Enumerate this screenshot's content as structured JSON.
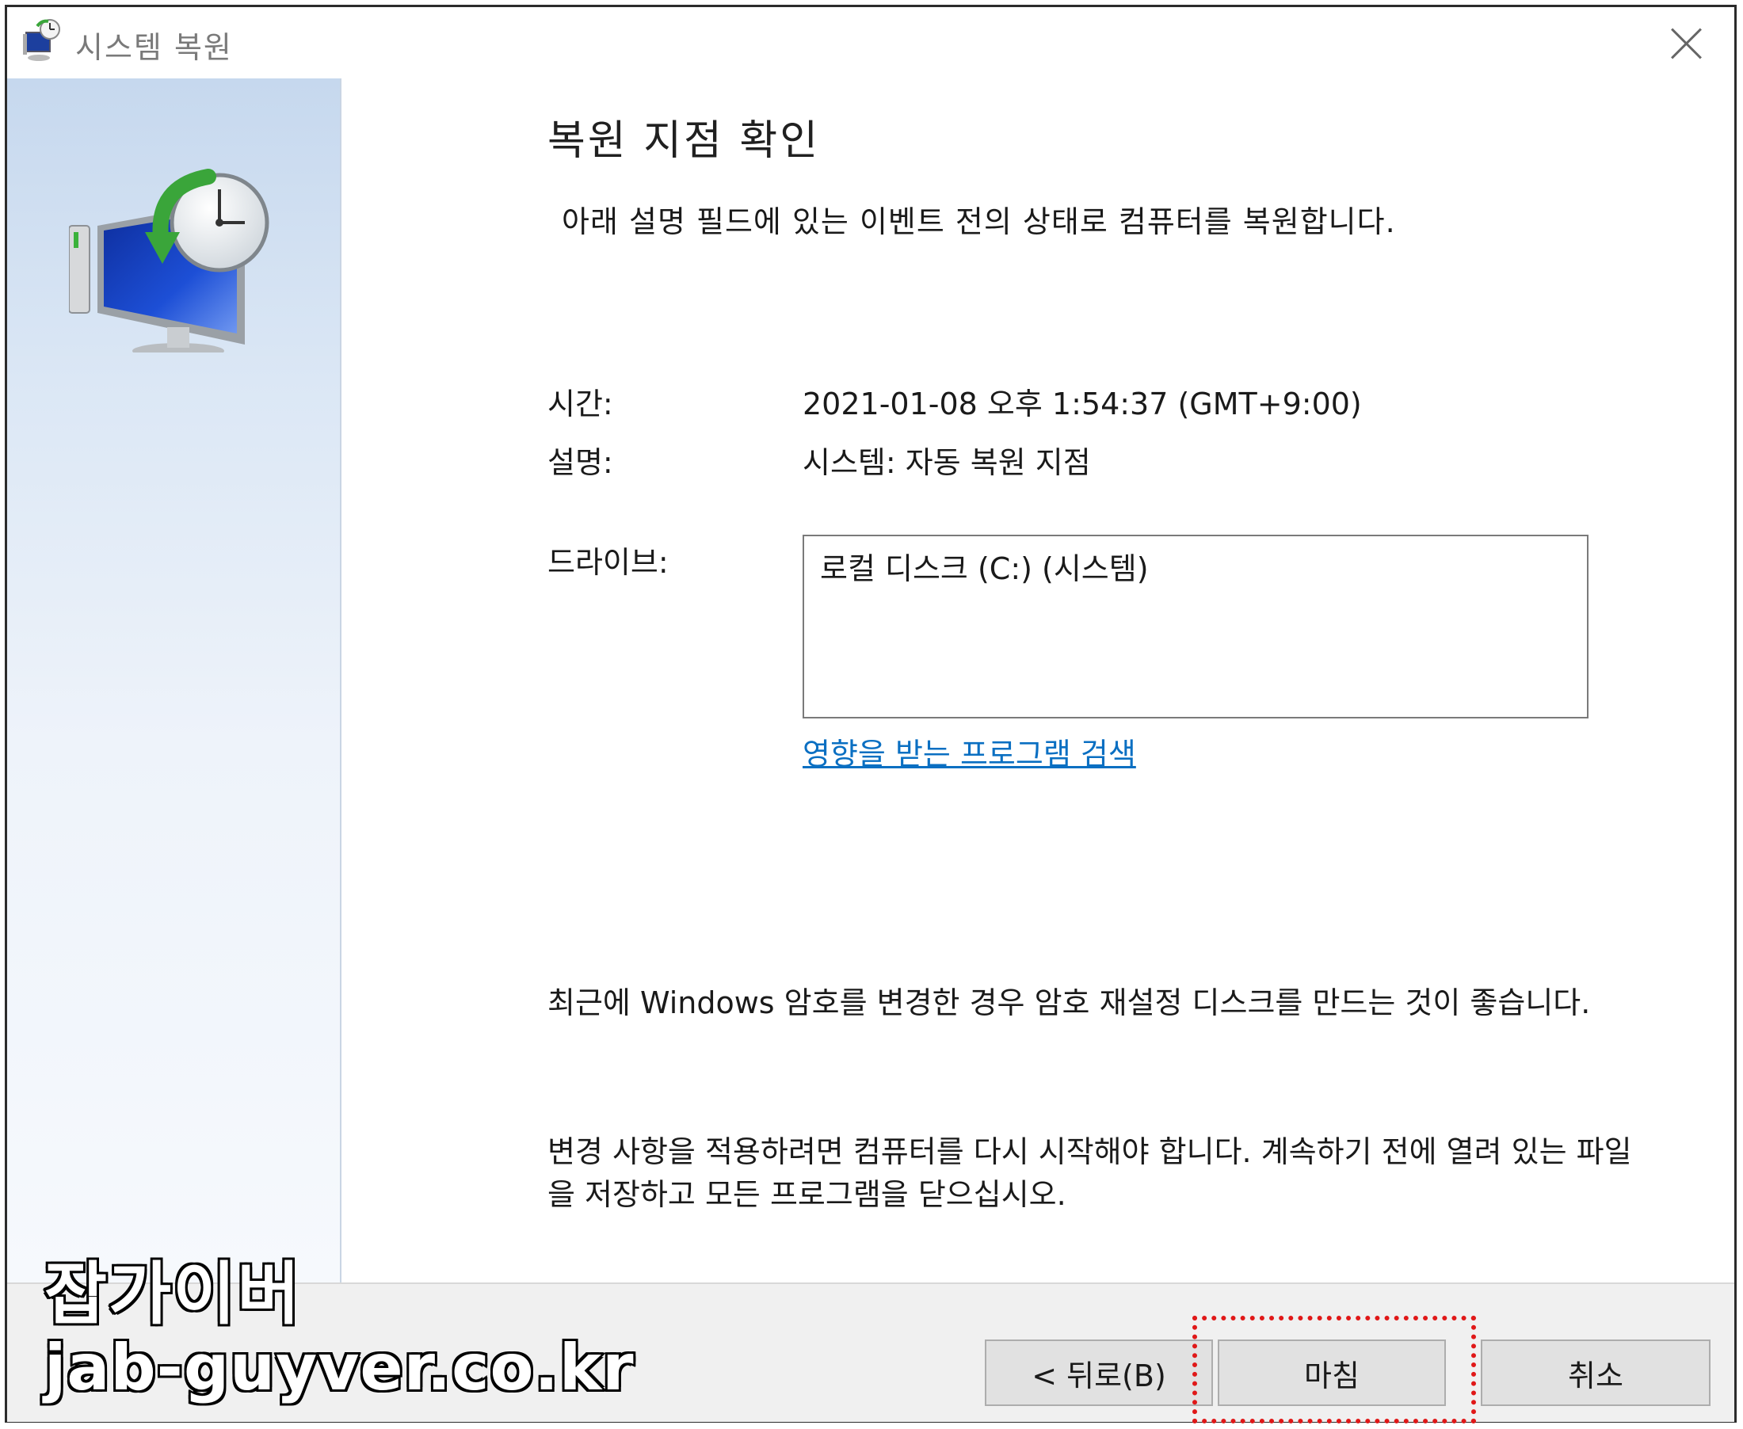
{
  "window": {
    "title": "시스템 복원",
    "icon": "system-restore-icon"
  },
  "main": {
    "heading": "복원 지점 확인",
    "subtext": "아래 설명 필드에 있는 이벤트 전의 상태로 컴퓨터를 복원합니다.",
    "time_label": "시간:",
    "time_value": "2021-01-08 오후 1:54:37 (GMT+9:00)",
    "description_label": "설명:",
    "description_value": "시스템: 자동 복원 지점",
    "drives_label": "드라이브:",
    "drives": [
      "로컬 디스크 (C:) (시스템)"
    ],
    "affected_programs_link": "영향을 받는 프로그램 검색",
    "password_note": "최근에 Windows 암호를 변경한 경우 암호 재설정 디스크를 만드는 것이 좋습니다.",
    "restart_note": "변경 사항을 적용하려면 컴퓨터를 다시 시작해야 합니다. 계속하기 전에 열려 있는 파일을 저장하고 모든 프로그램을 닫으십시오."
  },
  "buttons": {
    "back": "< 뒤로(B)",
    "finish": "마침",
    "cancel": "취소"
  },
  "watermark": {
    "line1": "잡가이버",
    "line2": "jab-guyver.co.kr"
  },
  "colors": {
    "link": "#0a6fc2",
    "highlight": "#e01818",
    "side_panel": "#c6d8ee"
  }
}
